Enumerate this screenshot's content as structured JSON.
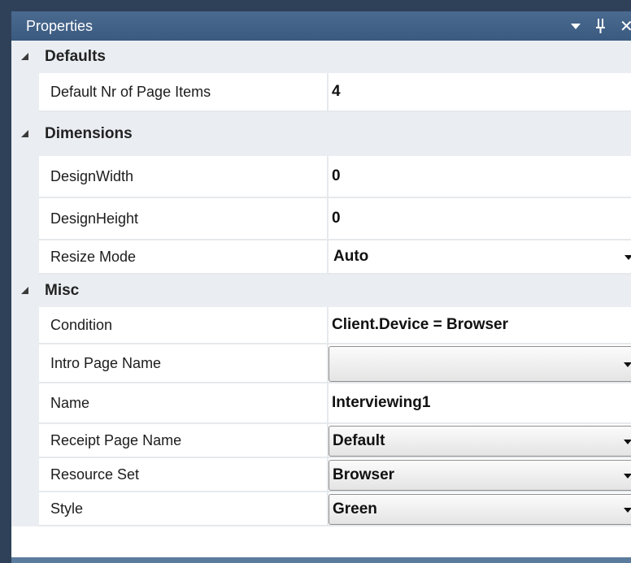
{
  "panel": {
    "title": "Properties",
    "menu_icon": "chevron-down-icon",
    "pin_glyph": "ꟷ",
    "close_glyph": "✕"
  },
  "categories": [
    {
      "label": "Defaults",
      "rows": [
        {
          "name": "Default Nr of Page Items",
          "value": "4",
          "type": "text"
        }
      ]
    },
    {
      "label": "Dimensions",
      "rows": [
        {
          "name": "DesignWidth",
          "value": "0",
          "type": "text"
        },
        {
          "name": "DesignHeight",
          "value": "0",
          "type": "text"
        },
        {
          "name": "Resize Mode",
          "value": "Auto",
          "type": "dropdown-plain"
        }
      ]
    },
    {
      "label": "Misc",
      "rows": [
        {
          "name": "Condition",
          "value": "Client.Device = Browser",
          "type": "text"
        },
        {
          "name": "Intro Page Name",
          "value": "",
          "type": "combo"
        },
        {
          "name": "Name",
          "value": "Interviewing1",
          "type": "text"
        },
        {
          "name": "Receipt Page Name",
          "value": "Default",
          "type": "combo"
        },
        {
          "name": "Resource Set",
          "value": "Browser",
          "type": "combo"
        },
        {
          "name": "Style",
          "value": "Green",
          "type": "combo"
        }
      ]
    }
  ],
  "colors": {
    "frame": "#2f4159",
    "titlebar": "#3a5a80",
    "category_bg": "#eaeef2",
    "gridline": "#e6e9ec"
  }
}
